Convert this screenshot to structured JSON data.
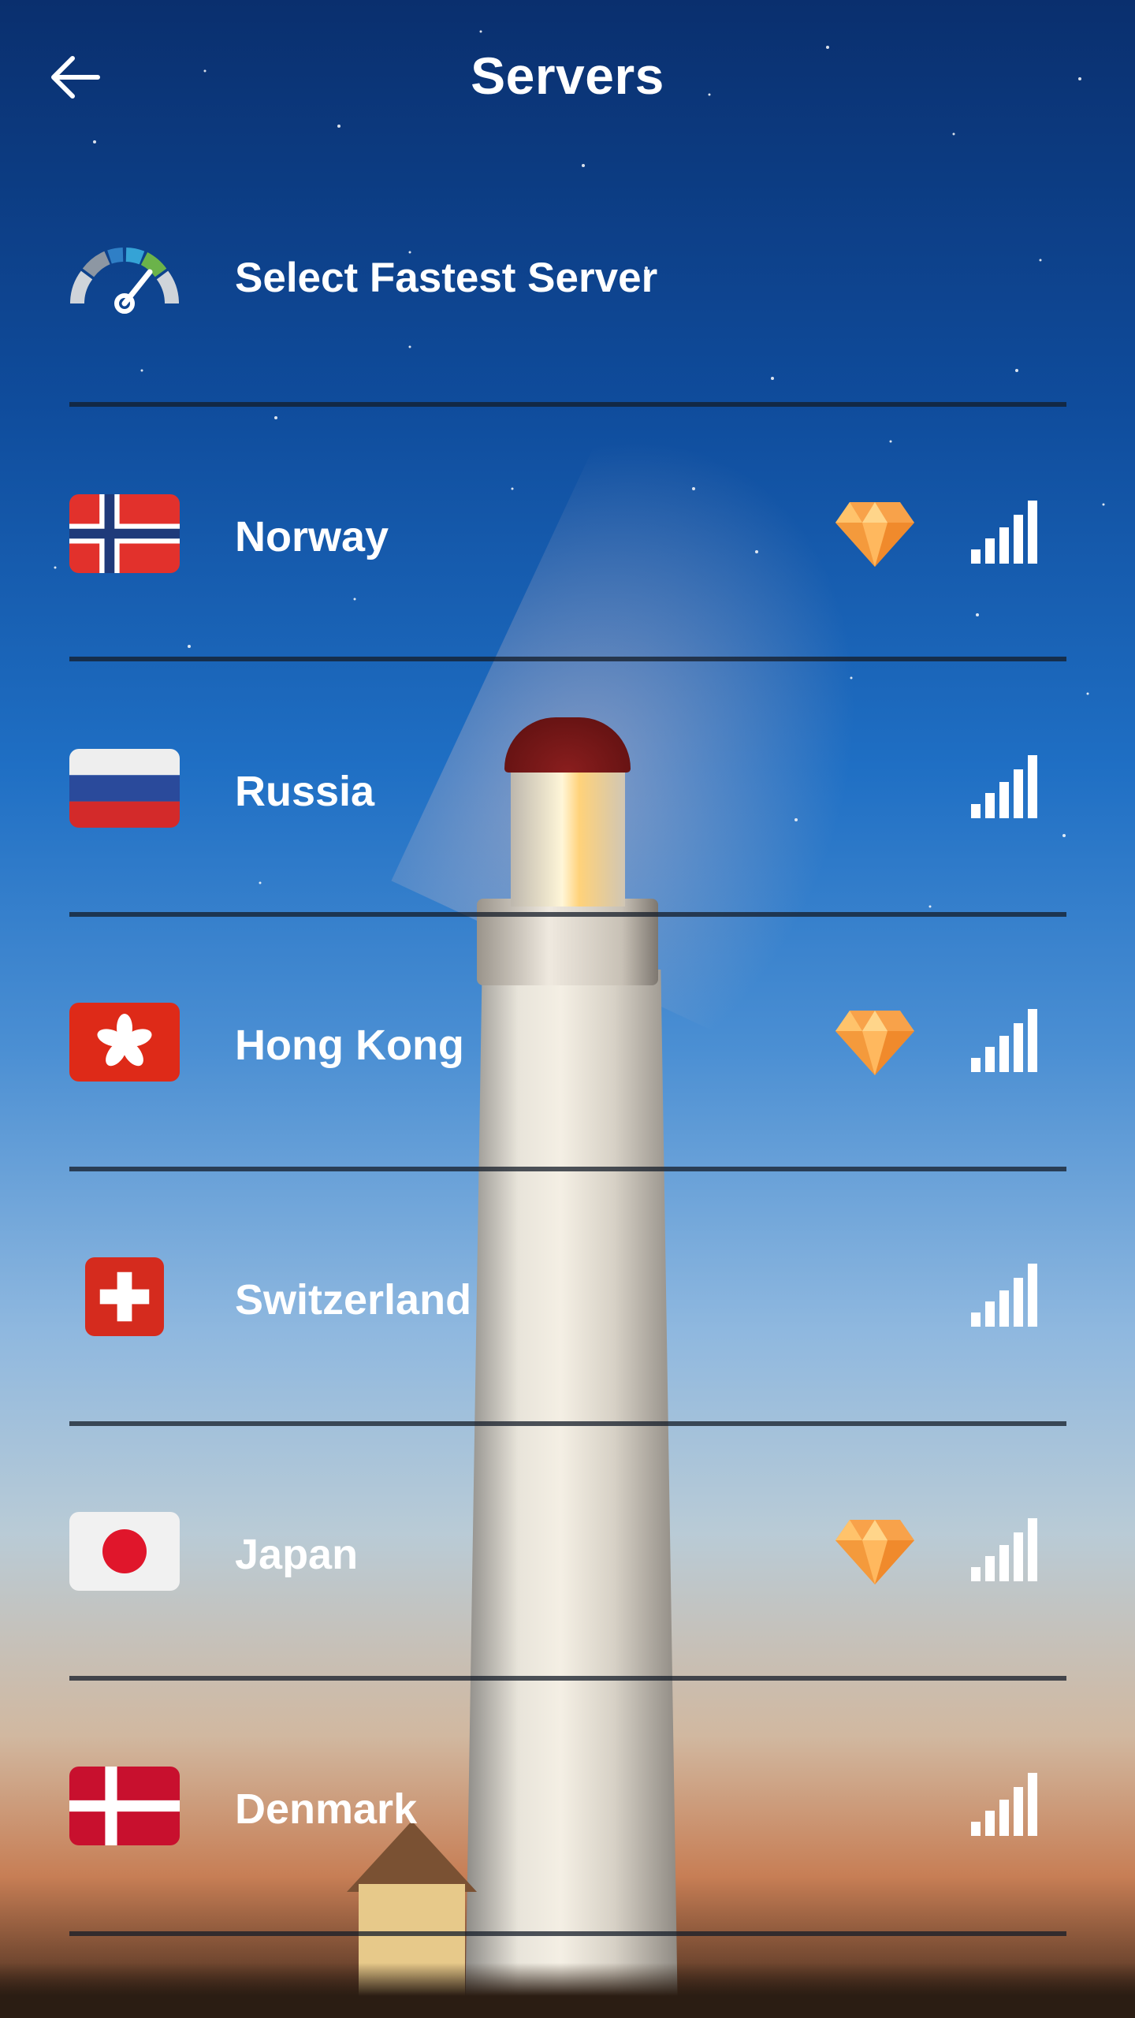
{
  "header": {
    "title": "Servers",
    "back_icon": "arrow-left-icon"
  },
  "fastest": {
    "label": "Select Fastest Server",
    "icon": "speedometer-icon"
  },
  "servers": [
    {
      "country": "Norway",
      "flag": "norway-flag-icon",
      "premium": true,
      "signal_bars": 5
    },
    {
      "country": "Russia",
      "flag": "russia-flag-icon",
      "premium": false,
      "signal_bars": 5
    },
    {
      "country": "Hong Kong",
      "flag": "hong-kong-flag-icon",
      "premium": true,
      "signal_bars": 5
    },
    {
      "country": "Switzerland",
      "flag": "switzerland-flag-icon",
      "premium": false,
      "signal_bars": 5
    },
    {
      "country": "Japan",
      "flag": "japan-flag-icon",
      "premium": true,
      "signal_bars": 5
    },
    {
      "country": "Denmark",
      "flag": "denmark-flag-icon",
      "premium": false,
      "signal_bars": 5
    }
  ],
  "colors": {
    "premium": "#f8a24a",
    "divider": "#141c28",
    "text": "#ffffff"
  }
}
